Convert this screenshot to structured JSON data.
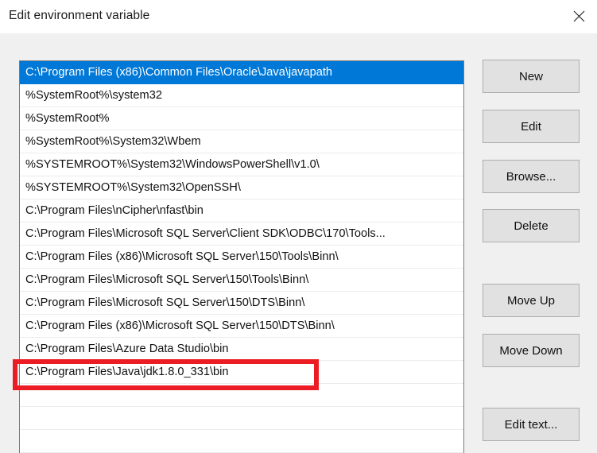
{
  "window": {
    "title": "Edit environment variable",
    "close_icon": "close-icon",
    "close_label": "Close"
  },
  "path_list": {
    "selected_index": 0,
    "items": [
      "C:\\Program Files (x86)\\Common Files\\Oracle\\Java\\javapath",
      "%SystemRoot%\\system32",
      "%SystemRoot%",
      "%SystemRoot%\\System32\\Wbem",
      "%SYSTEMROOT%\\System32\\WindowsPowerShell\\v1.0\\",
      "%SYSTEMROOT%\\System32\\OpenSSH\\",
      "C:\\Program Files\\nCipher\\nfast\\bin",
      "C:\\Program Files\\Microsoft SQL Server\\Client SDK\\ODBC\\170\\Tools...",
      "C:\\Program Files (x86)\\Microsoft SQL Server\\150\\Tools\\Binn\\",
      "C:\\Program Files\\Microsoft SQL Server\\150\\Tools\\Binn\\",
      "C:\\Program Files\\Microsoft SQL Server\\150\\DTS\\Binn\\",
      "C:\\Program Files (x86)\\Microsoft SQL Server\\150\\DTS\\Binn\\",
      "C:\\Program Files\\Azure Data Studio\\bin",
      "C:\\Program Files\\Java\\jdk1.8.0_331\\bin",
      "",
      "",
      ""
    ]
  },
  "buttons": {
    "new": "New",
    "edit": "Edit",
    "browse": "Browse...",
    "delete": "Delete",
    "move_up": "Move Up",
    "move_down": "Move Down",
    "edit_text": "Edit text..."
  },
  "annotation": {
    "target_row_index": 13,
    "target_text": "C:\\Program Files\\Java\\jdk1.8.0_331\\bin",
    "color": "#ec1c24"
  },
  "colors": {
    "selection": "#0078d7",
    "dialog_background": "#f0f0f0",
    "titlebar_background": "#ffffff",
    "list_background": "#ffffff",
    "button_face": "#e1e1e1",
    "button_border": "#adadad",
    "text": "#111111"
  }
}
